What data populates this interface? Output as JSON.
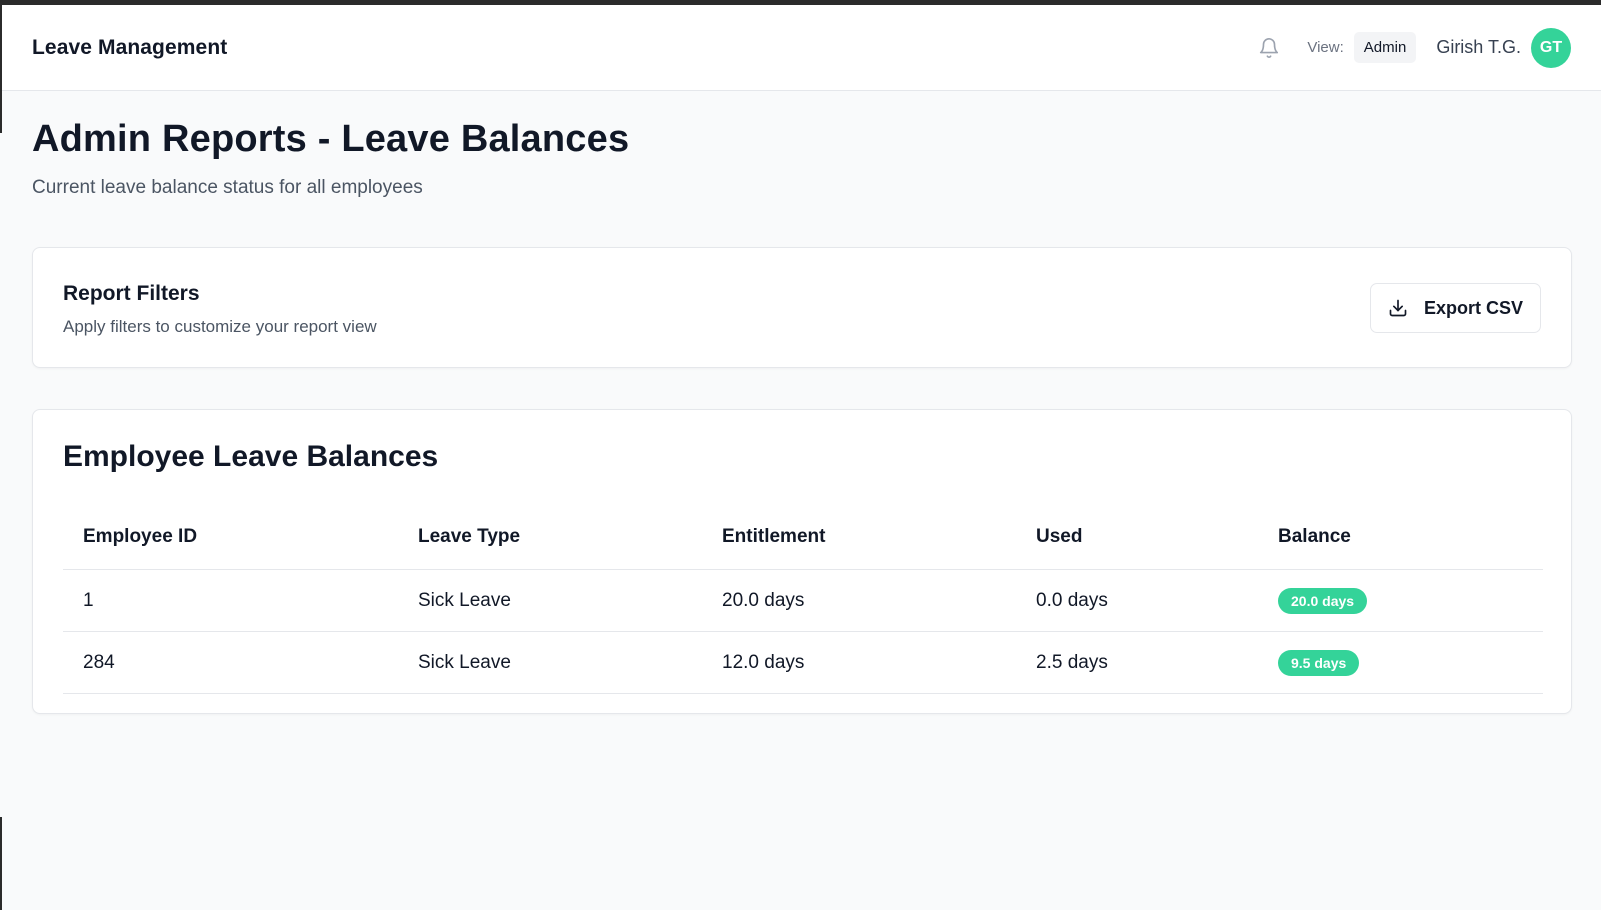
{
  "header": {
    "app_title": "Leave Management",
    "view_label": "View:",
    "view_value": "Admin",
    "user_name": "Girish T.G.",
    "avatar_initials": "GT",
    "icons": {
      "notifications": "bell-icon"
    }
  },
  "page": {
    "title": "Admin Reports - Leave Balances",
    "subtitle": "Current leave balance status for all employees"
  },
  "filters": {
    "title": "Report Filters",
    "description": "Apply filters to customize your report view",
    "export_label": "Export CSV",
    "export_icon": "download-icon"
  },
  "balances": {
    "title": "Employee Leave Balances",
    "columns": [
      "Employee ID",
      "Leave Type",
      "Entitlement",
      "Used",
      "Balance"
    ],
    "rows": [
      {
        "employee_id": "1",
        "leave_type": "Sick Leave",
        "entitlement": "20.0 days",
        "used": "0.0 days",
        "balance": "20.0 days"
      },
      {
        "employee_id": "284",
        "leave_type": "Sick Leave",
        "entitlement": "12.0 days",
        "used": "2.5 days",
        "balance": "9.5 days"
      }
    ]
  },
  "colors": {
    "accent_green": "#34d399",
    "text_primary": "#111827",
    "text_secondary": "#4b5563",
    "border": "#e5e7eb",
    "page_bg": "#f9fafb"
  }
}
